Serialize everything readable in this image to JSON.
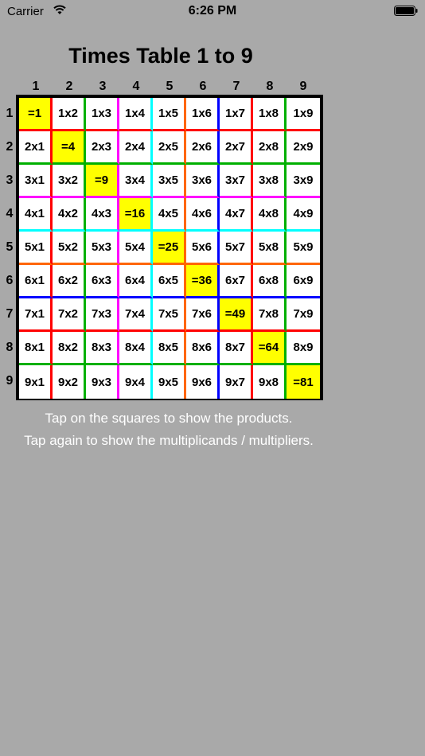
{
  "status_bar": {
    "carrier": "Carrier",
    "time": "6:26 PM",
    "wifi_icon": "wifi-icon",
    "battery_icon": "battery-icon"
  },
  "title": "Times Table 1 to 9",
  "column_headers": [
    "1",
    "2",
    "3",
    "4",
    "5",
    "6",
    "7",
    "8",
    "9"
  ],
  "row_headers": [
    "1",
    "2",
    "3",
    "4",
    "5",
    "6",
    "7",
    "8",
    "9"
  ],
  "line_colors": [
    "#ff0000",
    "#00b000",
    "#ff00ff",
    "#00ffff",
    "#ff6600",
    "#0000ff",
    "#ff0000",
    "#00b000",
    "#ff00ff"
  ],
  "product_color": "#ffff00",
  "cells": [
    [
      "=1",
      "1x2",
      "1x3",
      "1x4",
      "1x5",
      "1x6",
      "1x7",
      "1x8",
      "1x9"
    ],
    [
      "2x1",
      "=4",
      "2x3",
      "2x4",
      "2x5",
      "2x6",
      "2x7",
      "2x8",
      "2x9"
    ],
    [
      "3x1",
      "3x2",
      "=9",
      "3x4",
      "3x5",
      "3x6",
      "3x7",
      "3x8",
      "3x9"
    ],
    [
      "4x1",
      "4x2",
      "4x3",
      "=16",
      "4x5",
      "4x6",
      "4x7",
      "4x8",
      "4x9"
    ],
    [
      "5x1",
      "5x2",
      "5x3",
      "5x4",
      "=25",
      "5x6",
      "5x7",
      "5x8",
      "5x9"
    ],
    [
      "6x1",
      "6x2",
      "6x3",
      "6x4",
      "6x5",
      "=36",
      "6x7",
      "6x8",
      "6x9"
    ],
    [
      "7x1",
      "7x2",
      "7x3",
      "7x4",
      "7x5",
      "7x6",
      "=49",
      "7x8",
      "7x9"
    ],
    [
      "8x1",
      "8x2",
      "8x3",
      "8x4",
      "8x5",
      "8x6",
      "8x7",
      "=64",
      "8x9"
    ],
    [
      "9x1",
      "9x2",
      "9x3",
      "9x4",
      "9x5",
      "9x6",
      "9x7",
      "9x8",
      "=81"
    ]
  ],
  "instructions": {
    "line1": "Tap on the squares to show the products.",
    "line2": "Tap again to show the multiplicands / multipliers."
  }
}
